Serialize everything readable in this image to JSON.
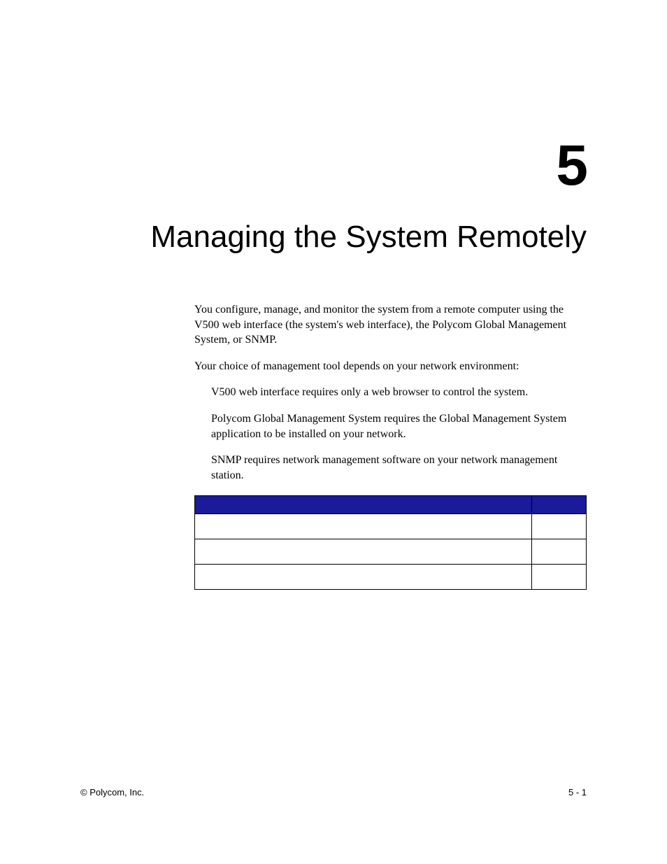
{
  "chapter": {
    "number": "5",
    "title": "Managing the System Remotely"
  },
  "paragraphs": {
    "p1": "You configure, manage, and monitor the system from a remote computer using the V500 web interface (the system's web interface), the Polycom Global Management System, or SNMP.",
    "p2": "Your choice of management tool depends on your network environment:",
    "b1": "V500 web interface requires only a web browser to control the system.",
    "b2": "Polycom Global Management System requires the Global Management System application to be installed on your network.",
    "b3": "SNMP requires network management software on your network management station."
  },
  "table": {
    "header_left": "",
    "header_right": "",
    "rows": [
      {
        "left": "",
        "right": ""
      },
      {
        "left": "",
        "right": ""
      },
      {
        "left": "",
        "right": ""
      }
    ]
  },
  "footer": {
    "left": "© Polycom, Inc.",
    "right": "5 - 1"
  }
}
